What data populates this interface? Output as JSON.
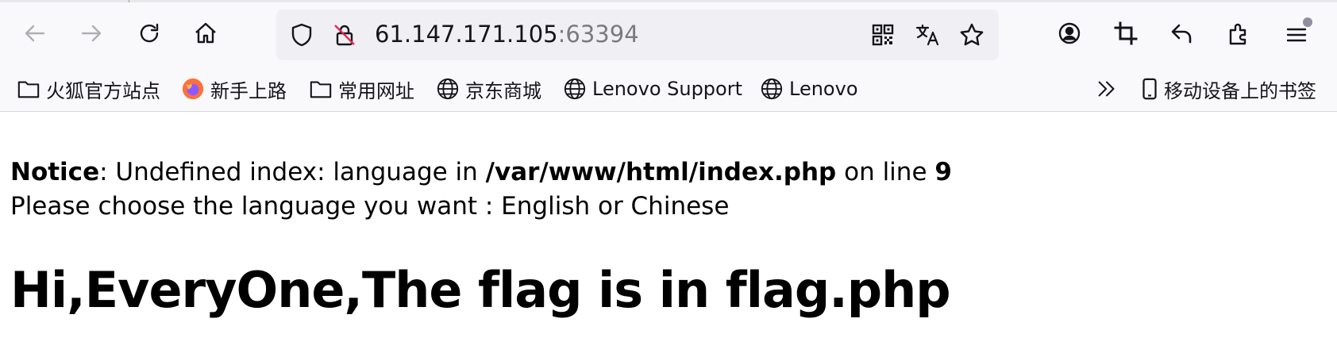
{
  "toolbar": {
    "back_icon": "arrow-left-icon",
    "forward_icon": "arrow-right-icon",
    "reload_icon": "reload-icon",
    "home_icon": "home-icon"
  },
  "url_bar": {
    "host": "61.147.171.105",
    "port": ":63394",
    "left_icons": [
      "shield-icon",
      "insecure-lock-icon"
    ],
    "right_icons": [
      "qr-code-icon",
      "translate-icon",
      "star-icon"
    ]
  },
  "toolbar_right_icons": [
    "account-icon",
    "crop-icon",
    "undo-icon",
    "extensions-icon",
    "menu-icon"
  ],
  "bookmarks": {
    "items": [
      {
        "label": "火狐官方站点",
        "icon": "folder-icon"
      },
      {
        "label": "新手上路",
        "icon": "firefox-icon"
      },
      {
        "label": "常用网址",
        "icon": "folder-icon"
      },
      {
        "label": "京东商城",
        "icon": "globe-icon"
      },
      {
        "label": "Lenovo Support",
        "icon": "globe-icon"
      },
      {
        "label": "Lenovo",
        "icon": "globe-icon"
      }
    ],
    "overflow_icon": "chevrons-right-icon",
    "mobile": {
      "label": "移动设备上的书签",
      "icon": "mobile-icon"
    }
  },
  "page": {
    "notice_label": "Notice",
    "notice_text": ": Undefined index: language in ",
    "notice_path": "/var/www/html/index.php",
    "notice_on_line": " on line ",
    "notice_line_number": "9",
    "prompt": "Please choose the language you want : English or Chinese",
    "heading": "Hi,EveryOne,The flag is in flag.php"
  },
  "colors": {
    "chrome_bg": "#f9f9fb",
    "url_bar_bg": "#f0f0f4",
    "icon_color": "#15141a",
    "disabled_icon": "#aeaeb3",
    "port_color": "#7a7a80"
  }
}
